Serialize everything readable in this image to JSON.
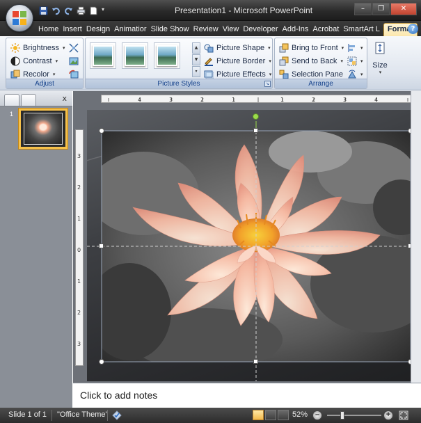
{
  "window": {
    "title": "Presentation1 - Microsoft PowerPoint",
    "controls": [
      "minimize",
      "restore",
      "close"
    ]
  },
  "quick_access": {
    "icons": [
      "office-logo",
      "save-icon",
      "undo-icon",
      "redo-icon",
      "print-icon",
      "document-icon",
      "customize-dropdown-icon"
    ]
  },
  "tabs": [
    {
      "label": "Home"
    },
    {
      "label": "Insert"
    },
    {
      "label": "Design"
    },
    {
      "label": "Animatior"
    },
    {
      "label": "Slide Show"
    },
    {
      "label": "Review"
    },
    {
      "label": "View"
    },
    {
      "label": "Developer"
    },
    {
      "label": "Add-Ins"
    },
    {
      "label": "Acrobat"
    },
    {
      "label": "SmartArt L"
    },
    {
      "label": "Format",
      "active": true
    }
  ],
  "ribbon": {
    "adjust": {
      "label": "Adjust",
      "brightness": "Brightness",
      "contrast": "Contrast",
      "recolor": "Recolor"
    },
    "picture_styles": {
      "label": "Picture Styles",
      "shape": "Picture Shape",
      "border": "Picture Border",
      "effects": "Picture Effects"
    },
    "arrange": {
      "label": "Arrange",
      "bring_front": "Bring to Front",
      "send_back": "Send to Back",
      "selection_pane": "Selection Pane"
    },
    "size": {
      "label": "Size"
    }
  },
  "slides_pane": {
    "slide_number": "1",
    "close_glyph": "x"
  },
  "notes": {
    "placeholder": "Click to add notes"
  },
  "status": {
    "slide": "Slide 1 of 1",
    "theme": "\"Office Theme\"",
    "zoom": "52%",
    "zoom_level": 0.52
  },
  "colors": {
    "active_tab": "#fbe7ad",
    "ribbon_label": "#15428b",
    "lotus_center": "#f4a623",
    "lotus_petal": "#f7c6b2"
  }
}
